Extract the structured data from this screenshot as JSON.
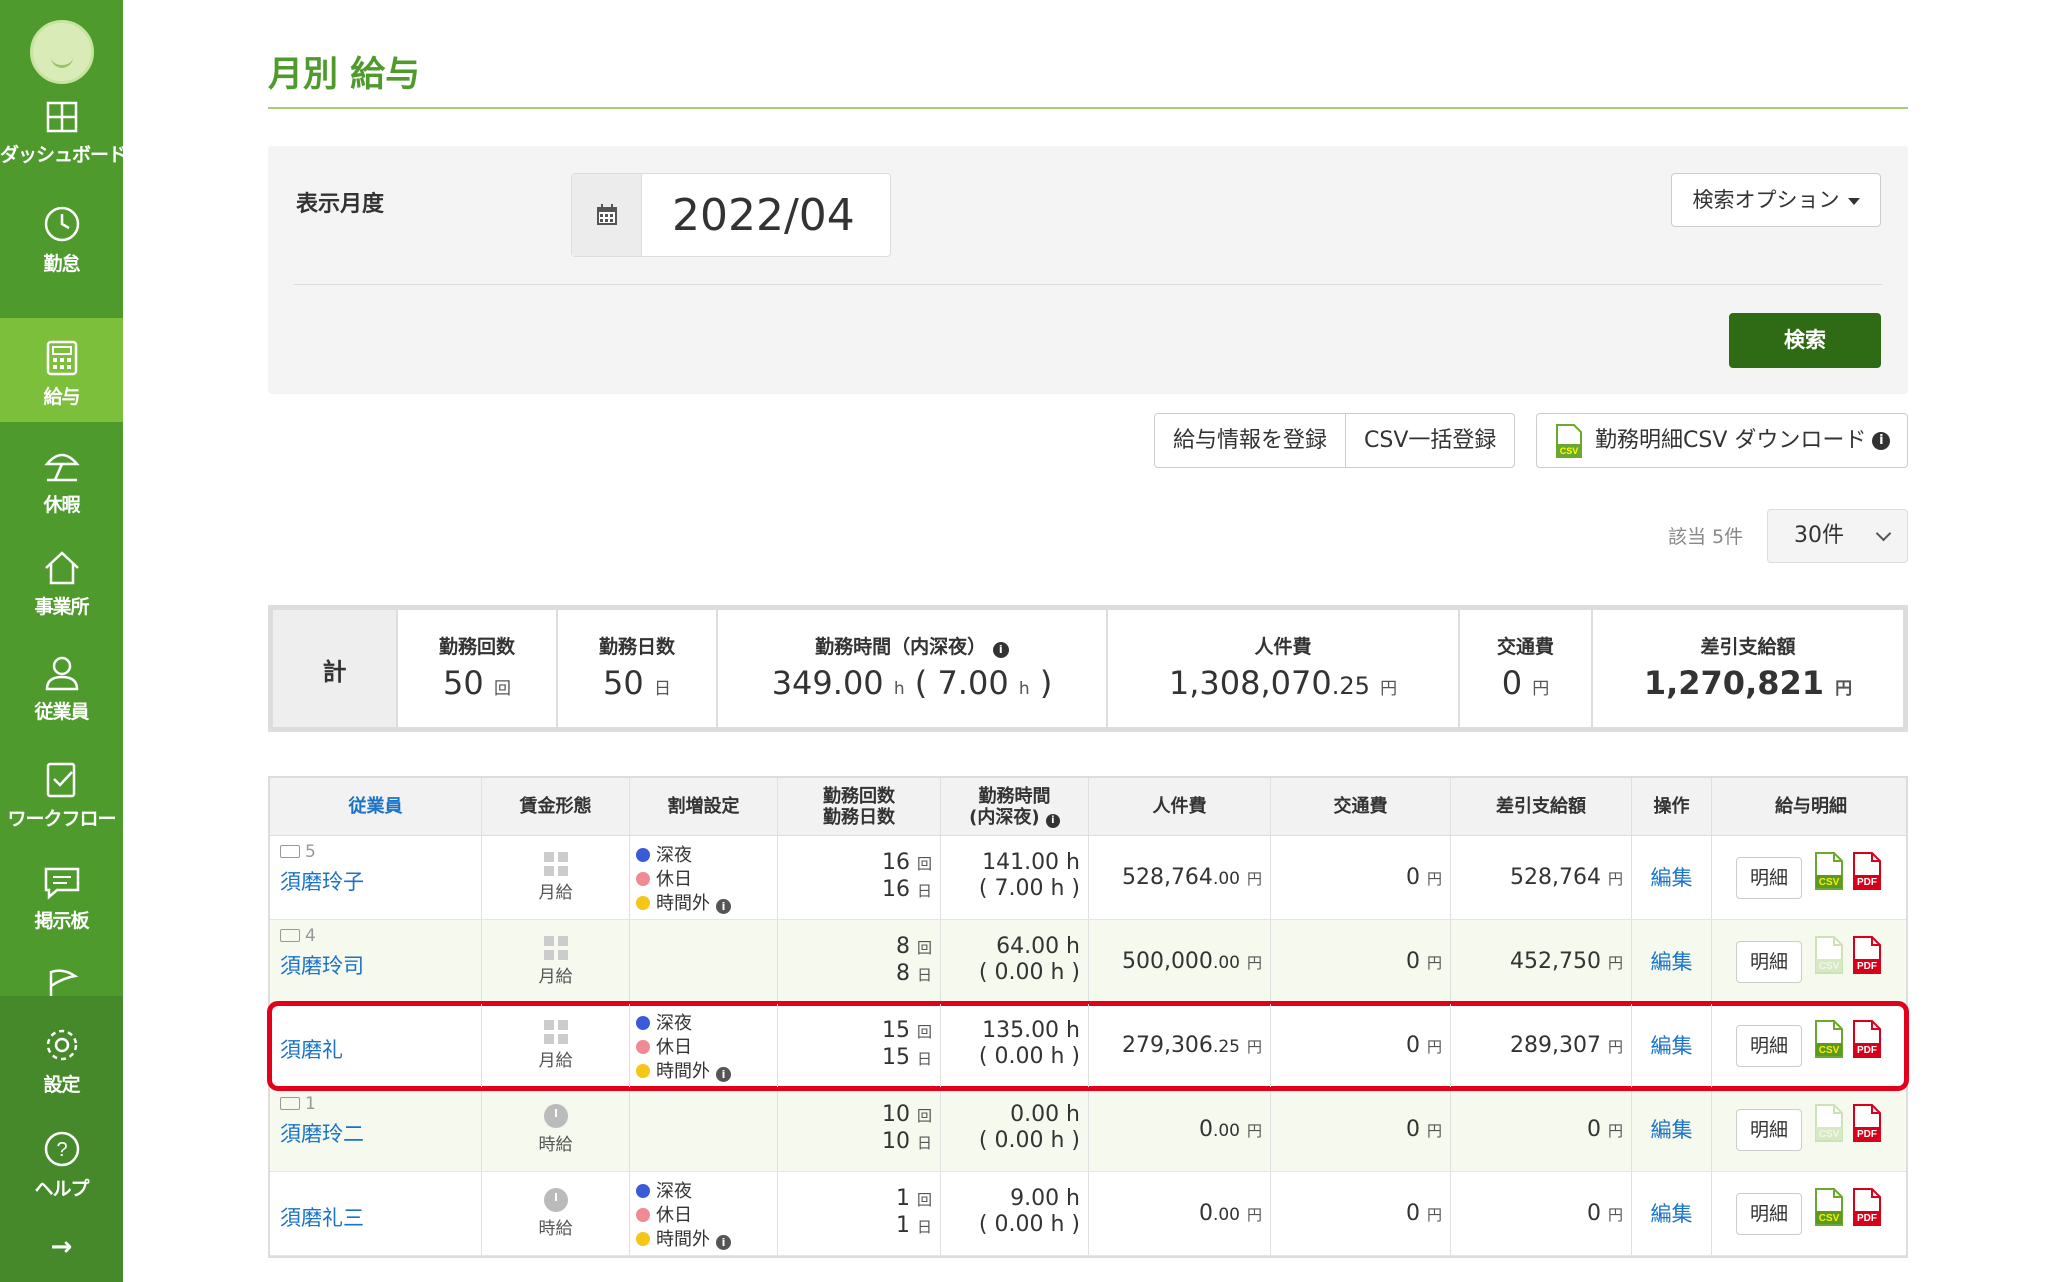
{
  "sidebar": {
    "items": [
      {
        "label": "ダッシュボード",
        "icon": "dashboard-icon"
      },
      {
        "label": "勤怠",
        "icon": "clock-icon"
      },
      {
        "label": "給与",
        "icon": "calculator-icon",
        "active": true
      },
      {
        "label": "休暇",
        "icon": "umbrella-icon"
      },
      {
        "label": "事業所",
        "icon": "home-icon"
      },
      {
        "label": "従業員",
        "icon": "person-icon"
      },
      {
        "label": "ワークフロー",
        "icon": "clipboard-check-icon"
      },
      {
        "label": "掲示板",
        "icon": "chat-icon"
      },
      {
        "label": "",
        "icon": "flag-icon"
      },
      {
        "label": "設定",
        "icon": "gear-icon"
      },
      {
        "label": "ヘルプ",
        "icon": "help-icon"
      },
      {
        "label": "→",
        "icon": "arrow-right-icon"
      }
    ],
    "accent": "#4f9a2d"
  },
  "page": {
    "title": "月別 給与"
  },
  "search": {
    "month_label": "表示月度",
    "month_value": "2022/04",
    "options_label": "検索オプション",
    "search_label": "検索"
  },
  "actions": {
    "register": "給与情報を登録",
    "csv_bulk": "CSV一括登録",
    "download": "勤務明細CSV ダウンロード"
  },
  "paging": {
    "count_text": "該当 5件",
    "per_page": "30件"
  },
  "summary": {
    "label": "計",
    "work_count_h": "勤務回数",
    "work_count_v": "50",
    "work_count_u": "回",
    "work_days_h": "勤務日数",
    "work_days_v": "50",
    "work_days_u": "日",
    "work_hours_h": "勤務時間（内深夜）",
    "work_hours_v": "349.00",
    "work_hours_night": "7.00",
    "labor_h": "人件費",
    "labor_v": "1,308,070",
    "labor_dec": ".25",
    "transport_h": "交通費",
    "transport_v": "0",
    "net_h": "差引支給額",
    "net_v": "1,270,821",
    "u_yen": "円",
    "u_h": "h"
  },
  "table": {
    "headers": {
      "employee": "従業員",
      "wage_type": "賃金形態",
      "overtime": "割増設定",
      "count1": "勤務回数",
      "count2": "勤務日数",
      "hours1": "勤務時間",
      "hours2": "(内深夜)",
      "labor": "人件費",
      "transport": "交通費",
      "net": "差引支給額",
      "ops": "操作",
      "slip": "給与明細"
    },
    "ot_labels": {
      "night": "深夜",
      "holiday": "休日",
      "overtime": "時間外"
    },
    "u_times": "回",
    "u_days": "日",
    "u_yen": "円",
    "edit": "編集",
    "detail": "明細",
    "rows": [
      {
        "no": "5",
        "name": "須磨玲子",
        "wage": "月給",
        "ot": true,
        "count": "16",
        "days": "16",
        "hours": "141.00 h",
        "night": "( 7.00 h )",
        "labor": "528,764",
        "labor_dec": ".00",
        "transport": "0",
        "net": "528,764",
        "csv_enabled": true
      },
      {
        "no": "4",
        "name": "須磨玲司",
        "wage": "月給",
        "ot": false,
        "count": "8",
        "days": "8",
        "hours": "64.00 h",
        "night": "( 0.00 h )",
        "labor": "500,000",
        "labor_dec": ".00",
        "transport": "0",
        "net": "452,750",
        "csv_enabled": false
      },
      {
        "no": "",
        "name": "須磨礼",
        "wage": "月給",
        "ot": true,
        "count": "15",
        "days": "15",
        "hours": "135.00 h",
        "night": "( 0.00 h )",
        "labor": "279,306",
        "labor_dec": ".25",
        "transport": "0",
        "net": "289,307",
        "csv_enabled": true,
        "highlighted": true
      },
      {
        "no": "1",
        "name": "須磨玲二",
        "wage": "時給",
        "ot": false,
        "count": "10",
        "days": "10",
        "hours": "0.00 h",
        "night": "( 0.00 h )",
        "labor": "0",
        "labor_dec": ".00",
        "transport": "0",
        "net": "0",
        "csv_enabled": false
      },
      {
        "no": "",
        "name": "須磨礼三",
        "wage": "時給",
        "ot": true,
        "count": "1",
        "days": "1",
        "hours": "9.00 h",
        "night": "( 0.00 h )",
        "labor": "0",
        "labor_dec": ".00",
        "transport": "0",
        "net": "0",
        "csv_enabled": true
      }
    ]
  },
  "colors": {
    "night": "#3b5bd6",
    "holiday": "#f08a94",
    "overtime": "#f5c518",
    "highlight": "#e2001a",
    "search_btn": "#2e6b14"
  }
}
